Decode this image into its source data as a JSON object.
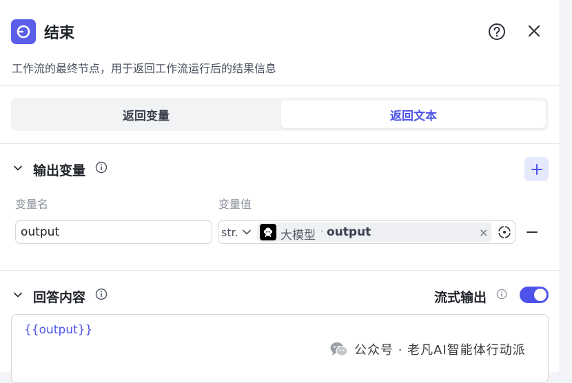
{
  "header": {
    "title": "结束",
    "description": "工作流的最终节点，用于返回工作流运行后的结果信息"
  },
  "tabs": [
    {
      "label": "返回变量",
      "active": false
    },
    {
      "label": "返回文本",
      "active": true
    }
  ],
  "output_section": {
    "title": "输出变量",
    "columns": {
      "name": "变量名",
      "value": "变量值"
    },
    "rows": [
      {
        "name": "output",
        "type": "str.",
        "ref_node": "大模型",
        "ref_separator": "·",
        "ref_var": "output"
      }
    ]
  },
  "answer_section": {
    "title": "回答内容",
    "stream_label": "流式输出",
    "stream_enabled": true,
    "content": "{{output}}"
  },
  "watermark": {
    "text": "公众号 · 老凡AI智能体行动派"
  },
  "colors": {
    "accent": "#4d53e8",
    "node_icon": "#5b5ee8",
    "add_button_bg": "#e6e8fc"
  },
  "icons": [
    "end-node-icon",
    "help-icon",
    "close-icon",
    "chevron-down-icon",
    "info-icon",
    "plus-icon",
    "model-icon",
    "clear-icon",
    "target-icon",
    "minus-icon",
    "wechat-icon"
  ]
}
